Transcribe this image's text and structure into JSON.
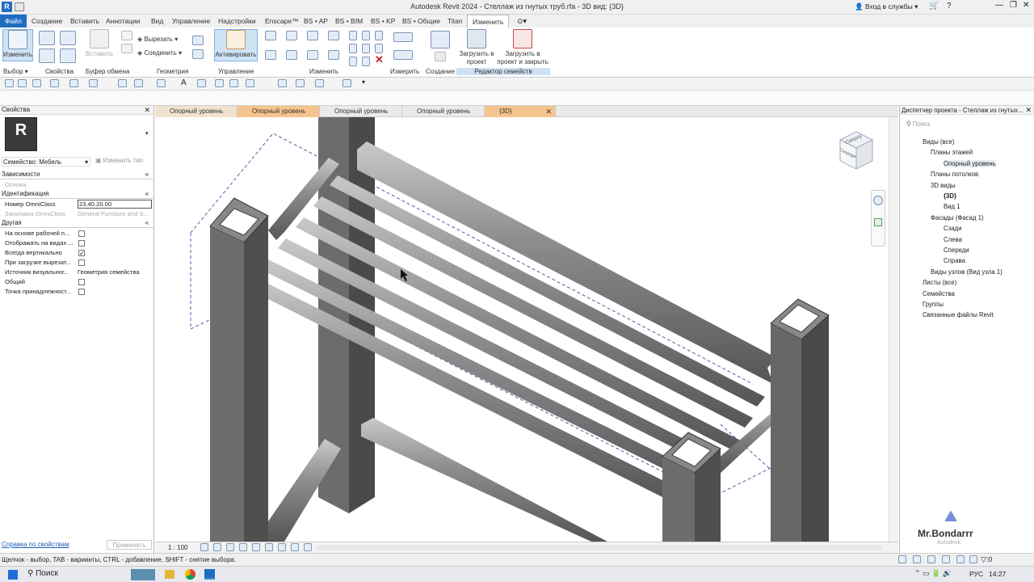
{
  "app": {
    "title": "Autodesk Revit 2024 - Стеллаж из гнутых труб.rfa - 3D вид: {3D}",
    "sign_in": "Вход в службы"
  },
  "tabs": [
    "Файл",
    "Создание",
    "Вставить",
    "Аннотации",
    "Вид",
    "Управление",
    "Надстройки",
    "Enscape™",
    "BS • AP",
    "BS • BIM",
    "BS • KP",
    "BS • Общие",
    "Titan",
    "Изменить"
  ],
  "ribbon": {
    "modify": "Изменить",
    "cut": "Вырезать",
    "join": "Соединить",
    "paste": "Вставить",
    "activate": "Активировать",
    "load_project": "Загрузить в проект",
    "load_close": "Загрузить в проект и закрыть",
    "panels": [
      "Выбор",
      "Свойства",
      "Буфер обмена",
      "Геометрия",
      "Управление",
      "Изменить",
      "Измерить",
      "Создание",
      "Редактор семейств"
    ]
  },
  "properties": {
    "title": "Свойства",
    "logo": "R",
    "family": "Семейство: Мебель",
    "edit_type": "Изменить тип",
    "groups": {
      "constraints": "Зависимости",
      "identity": "Идентификация",
      "other": "Другая"
    },
    "base": "Основа",
    "omni_num_label": "Номер OmniClass",
    "omni_num": "23.40.20.00",
    "omni_title_label": "Заголовок OmniClass",
    "omni_title": "General Furniture and S...",
    "other_rows": [
      {
        "label": "На основе рабочей п...",
        "checked": false
      },
      {
        "label": "Отображать на видах ...",
        "checked": false
      },
      {
        "label": "Всегда вертикально",
        "checked": true
      },
      {
        "label": "При загрузке вырезат...",
        "checked": false
      }
    ],
    "source_label": "Источник визуальног...",
    "source": "Геометрия семейства",
    "shared_label": "Общий",
    "shared_checked": false,
    "point_label": "Точка принадлежност...",
    "point_checked": false,
    "help": "Справка по свойствам",
    "apply": "Применить"
  },
  "view_tabs": [
    "Опорный уровень",
    "Опорный уровень",
    "Опорный уровень",
    "Опорный уровень",
    "{3D}"
  ],
  "viewcube": {
    "top": "Сверху",
    "front": "Спереди"
  },
  "view_control": {
    "scale": "1 : 100"
  },
  "browser": {
    "title": "Диспетчер проекта - Стеллаж из гнутых...",
    "search": "Поиск",
    "items": [
      {
        "label": "Виды (все)",
        "x": 10
      },
      {
        "label": "Планы этажей",
        "x": 20
      },
      {
        "label": "Опорный уровень",
        "x": 36
      },
      {
        "label": "Планы потолков",
        "x": 20
      },
      {
        "label": "3D виды",
        "x": 20
      },
      {
        "label": "{3D}",
        "x": 36,
        "bold": true
      },
      {
        "label": "Вид 1",
        "x": 36
      },
      {
        "label": "Фасады (Фасад 1)",
        "x": 20
      },
      {
        "label": "Сзади",
        "x": 36
      },
      {
        "label": "Слева",
        "x": 36
      },
      {
        "label": "Спереди",
        "x": 36
      },
      {
        "label": "Справа",
        "x": 36
      },
      {
        "label": "Виды узлов (Вид узла 1)",
        "x": 20
      },
      {
        "label": "Листы (все)",
        "x": 10
      },
      {
        "label": "Семейства",
        "x": 10
      },
      {
        "label": "Группы",
        "x": 10
      },
      {
        "label": "Связанные файлы Revit",
        "x": 10
      }
    ]
  },
  "status": {
    "text": "Щелчок - выбор, TAB - варианты, CTRL - добавление, SHIFT - снятие выбора.",
    "zero": ":0"
  },
  "watermark": {
    "name": "Mr.Bondarrr",
    "sub": "Autodesk"
  },
  "taskbar": {
    "search": "Поиск",
    "lang": "РУС",
    "time": "14:27"
  }
}
